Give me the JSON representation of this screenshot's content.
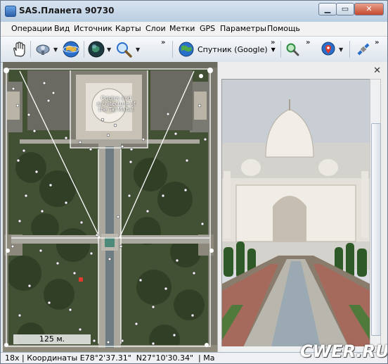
{
  "window": {
    "title": "SAS.Планета 90730",
    "buttons": {
      "minimize": "▁",
      "maximize": "▭",
      "close": "✕"
    }
  },
  "menu": [
    {
      "label": "Операции"
    },
    {
      "label": "Вид"
    },
    {
      "label": "Источник"
    },
    {
      "label": "Карты"
    },
    {
      "label": "Слои"
    },
    {
      "label": "Метки"
    },
    {
      "label": "GPS"
    },
    {
      "label": "Параметры"
    },
    {
      "label": "Помощь"
    }
  ],
  "toolbar": {
    "icons": [
      "hand-icon",
      "satellite-dish-icon",
      "globe-icon",
      "globe-dark-icon",
      "magnifier-icon"
    ],
    "map_type_label": "Спутник (Google)",
    "right_icons": [
      "search-marks-icon",
      "layer-marker-icon",
      "satellite-small-icon"
    ]
  },
  "map": {
    "label": "Origins and architecture of the Taj Mahal",
    "scale": "125 м."
  },
  "panel": {
    "close_symbol": "✕"
  },
  "status": {
    "text": "18x | Координаты E78°2'37.31\"  N27°10'30.34\"  | Ма"
  },
  "watermark": "CWER.RU",
  "colors": {
    "title_bar": "#c7d6e7",
    "map_vegetation": "#3b4a2e",
    "map_path": "#a9a79e",
    "accent_globe": "#2a6fc9"
  }
}
